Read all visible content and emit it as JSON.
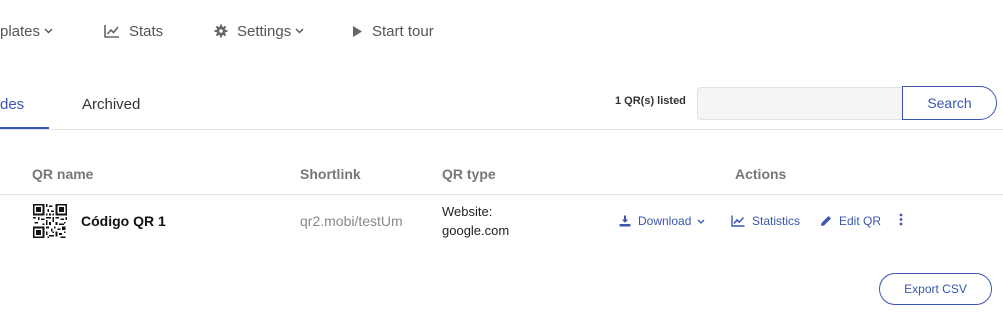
{
  "nav": {
    "templates_label": "plates",
    "stats_label": "Stats",
    "settings_label": "Settings",
    "tour_label": "Start tour"
  },
  "tabs": {
    "codes_label": "des",
    "archived_label": "Archived"
  },
  "listing": {
    "count_label": "1 QR(s) listed"
  },
  "search": {
    "value": "",
    "placeholder": "",
    "button_label": "Search"
  },
  "table": {
    "headers": {
      "name": "QR name",
      "shortlink": "Shortlink",
      "type": "QR type",
      "actions": "Actions"
    },
    "rows": [
      {
        "name": "Código QR 1",
        "shortlink": "qr2.mobi/testUm",
        "type_line1": "Website:",
        "type_line2": "google.com"
      }
    ]
  },
  "actions": {
    "download_label": "Download",
    "statistics_label": "Statistics",
    "edit_label": "Edit QR"
  },
  "export": {
    "label": "Export CSV"
  },
  "colors": {
    "accent": "#3a56b0",
    "text": "#333333",
    "muted": "#777777"
  }
}
